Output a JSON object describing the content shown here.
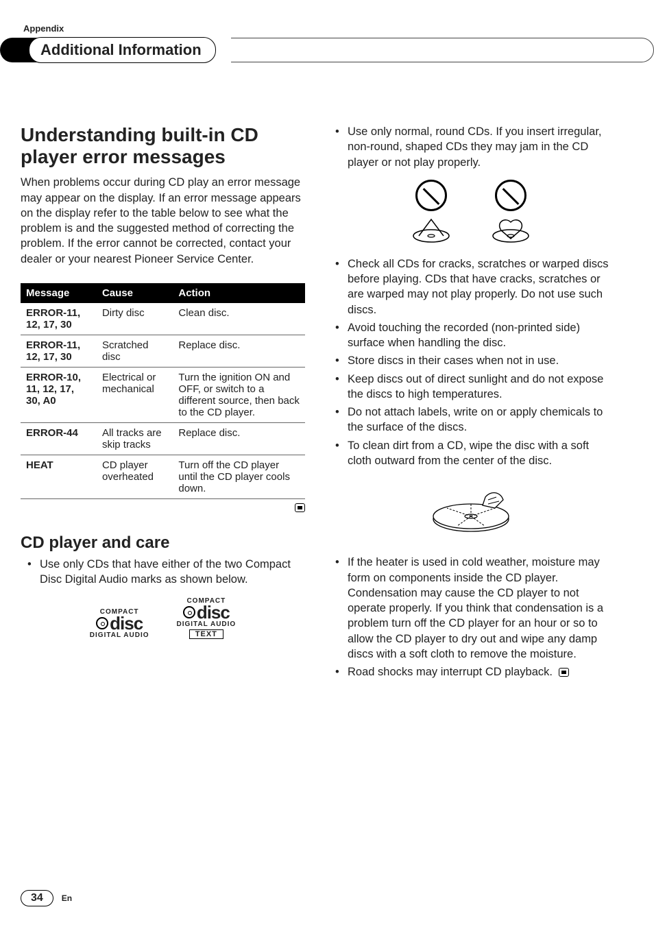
{
  "header": {
    "appendix_label": "Appendix",
    "section_title": "Additional Information"
  },
  "left": {
    "h1": "Understanding built-in CD player error messages",
    "intro": "When problems occur during CD play an error message may appear on the display. If an error message appears on the display refer to the table below to see what the problem is and the suggested method of correcting the problem. If the error cannot be corrected, contact your dealer or your nearest Pioneer Service Center.",
    "table": {
      "headers": [
        "Message",
        "Cause",
        "Action"
      ],
      "rows": [
        {
          "msg": "ERROR-11, 12, 17, 30",
          "cause": "Dirty disc",
          "action": "Clean disc."
        },
        {
          "msg": "ERROR-11, 12, 17, 30",
          "cause": "Scratched disc",
          "action": "Replace disc."
        },
        {
          "msg": "ERROR-10, 11, 12, 17, 30, A0",
          "cause": "Electrical or mechanical",
          "action": "Turn the ignition ON and OFF, or switch to a different source, then back to the CD player."
        },
        {
          "msg": "ERROR-44",
          "cause": "All tracks are skip tracks",
          "action": "Replace disc."
        },
        {
          "msg": "HEAT",
          "cause": "CD player overheated",
          "action": "Turn off the CD player until the CD player cools down."
        }
      ]
    },
    "h2": "CD player and care",
    "care_bullet": "Use only CDs that have either of the two Compact Disc Digital Audio marks as shown below.",
    "logo_labels": {
      "compact": "COMPACT",
      "digital": "DIGITAL AUDIO",
      "text": "TEXT"
    }
  },
  "right": {
    "bullets_a": [
      "Use only normal, round CDs. If you insert irregular, non-round, shaped CDs they may jam in the CD player or not play properly."
    ],
    "bullets_b": [
      "Check all CDs for cracks, scratches or warped discs before playing. CDs that have cracks, scratches or are warped may not play properly. Do not use such discs.",
      "Avoid touching the recorded (non-printed side) surface when handling the disc.",
      "Store discs in their cases when not in use.",
      "Keep discs out of direct sunlight and do not expose the discs to high temperatures.",
      "Do not attach labels, write on or apply chemicals to the surface of the discs.",
      "To clean dirt from a CD, wipe the disc with a soft cloth outward from the center of the disc."
    ],
    "bullets_c": [
      "If the heater is used in cold weather, moisture may form on components inside the CD player. Condensation may cause the CD player to not operate properly. If you think that condensation is a problem turn off the CD player for an hour or so to allow the CD player to dry out and wipe any damp discs with a soft cloth to remove the moisture.",
      "Road shocks may interrupt CD playback."
    ]
  },
  "footer": {
    "page": "34",
    "lang": "En"
  }
}
